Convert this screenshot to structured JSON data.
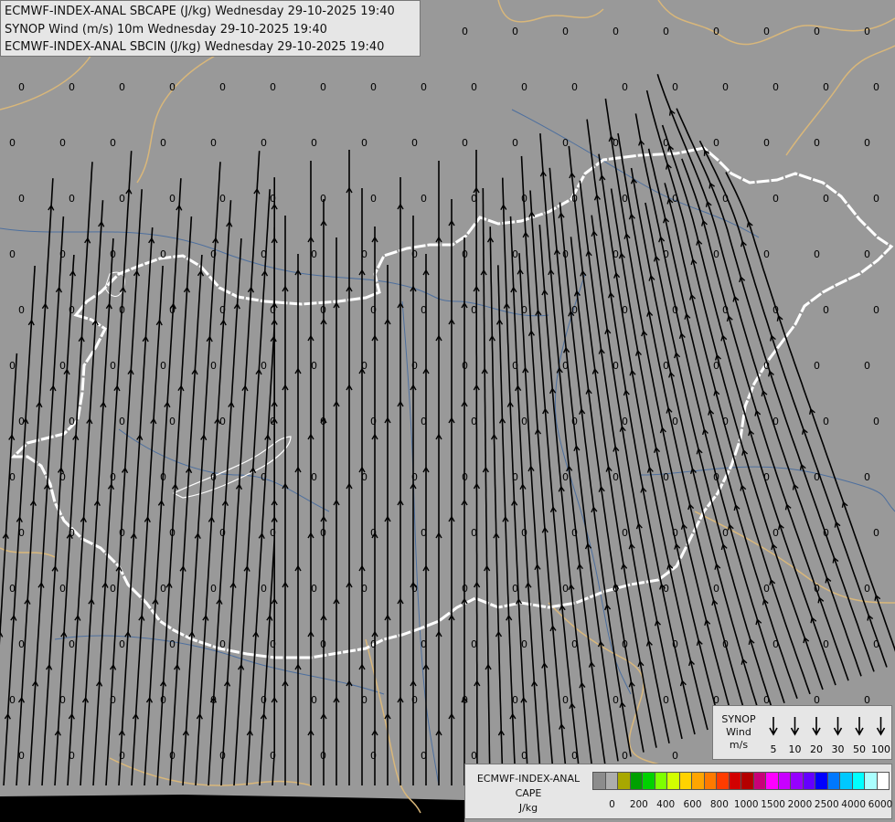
{
  "header": {
    "line1": "ECMWF-INDEX-ANAL SBCAPE (J/kg) Wednesday 29-10-2025 19:40",
    "line2": "SYNOP Wind (m/s) 10m Wednesday 29-10-2025 19:40",
    "line3": "ECMWF-INDEX-ANAL SBCIN (J/kg) Wednesday 29-10-2025 19:40"
  },
  "map": {
    "background_color": "#999999",
    "border_color": "#ffffff",
    "neighbor_border_color": "#d9b77a",
    "river_color": "#4d6f9e",
    "streamline_color": "#000000",
    "value_label": "0"
  },
  "wind_legend": {
    "title_line1": "SYNOP",
    "title_line2": "Wind",
    "unit": "m/s",
    "speeds": [
      "5",
      "10",
      "20",
      "30",
      "50",
      "100"
    ]
  },
  "cape_legend": {
    "title_line1": "ECMWF-INDEX-ANAL",
    "title_line2": "CAPE",
    "unit": "J/kg",
    "colors": [
      "#8c8c8c",
      "#adadad",
      "#a8a800",
      "#00a000",
      "#00d200",
      "#7dff00",
      "#d2ff00",
      "#ffd200",
      "#ffa500",
      "#ff7a00",
      "#ff3c00",
      "#d20000",
      "#b40000",
      "#c80078",
      "#ff00ff",
      "#c800ff",
      "#9600ff",
      "#6400ff",
      "#0000ff",
      "#0078ff",
      "#00c8ff",
      "#00ffff",
      "#aaffff",
      "#ffffff"
    ],
    "ticks": [
      "0",
      "200",
      "400",
      "600",
      "800",
      "1000",
      "1500",
      "2000",
      "2500",
      "4000",
      "6000"
    ]
  }
}
